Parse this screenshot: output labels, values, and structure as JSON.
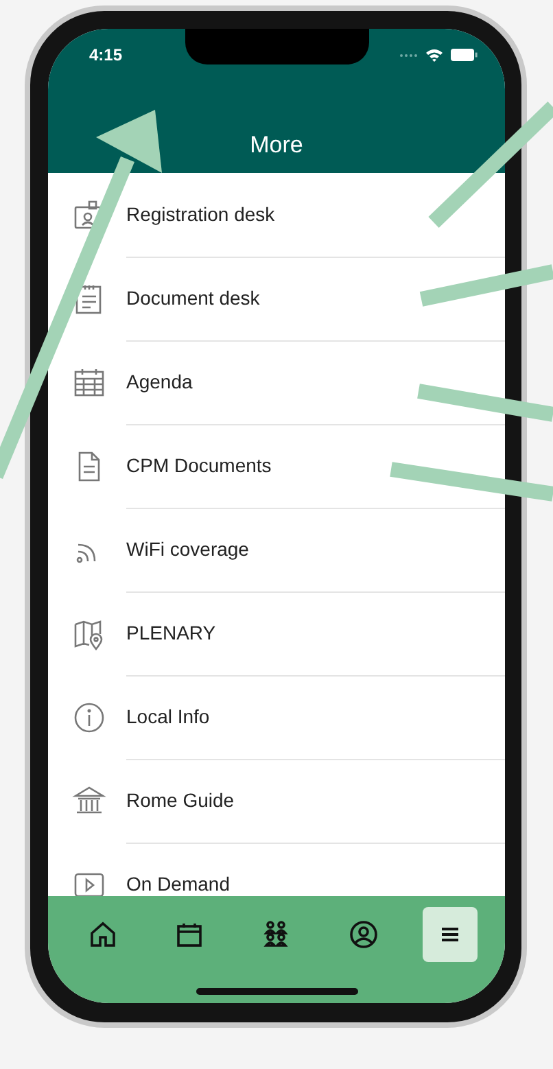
{
  "status_bar": {
    "time": "4:15"
  },
  "header": {
    "title": "More"
  },
  "menu": [
    {
      "label": "Registration desk"
    },
    {
      "label": "Document desk"
    },
    {
      "label": "Agenda"
    },
    {
      "label": "CPM Documents"
    },
    {
      "label": "WiFi coverage"
    },
    {
      "label": "PLENARY"
    },
    {
      "label": "Local Info"
    },
    {
      "label": "Rome Guide"
    },
    {
      "label": "On Demand"
    }
  ],
  "tab_bar": [
    {
      "selected": false
    },
    {
      "selected": false
    },
    {
      "selected": false
    },
    {
      "selected": false
    },
    {
      "selected": true
    }
  ]
}
